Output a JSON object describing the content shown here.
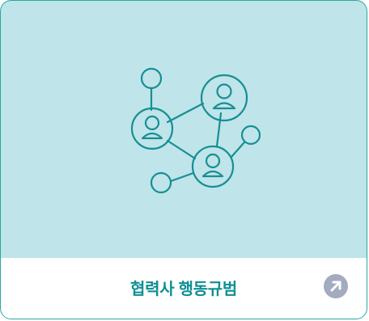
{
  "card": {
    "title": "협력사 행동규범",
    "illustration_icon": "network-people-icon",
    "link_icon": "arrow-up-right-icon"
  },
  "colors": {
    "card_background": "#bfe4e9",
    "border": "#2aa8a0",
    "title_text": "#0f8f92",
    "icon_stroke": "#168f93",
    "link_button": "#a3abc1"
  }
}
